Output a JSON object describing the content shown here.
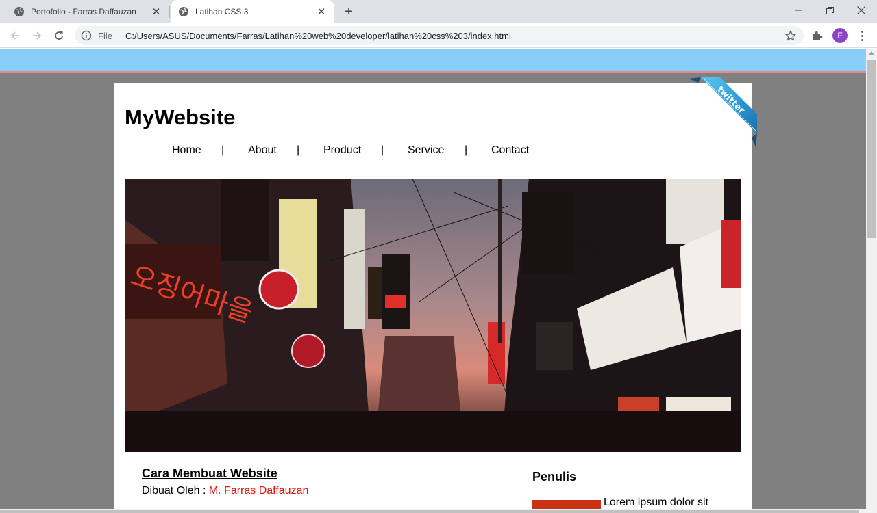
{
  "browser": {
    "tabs": [
      {
        "title": "Portofolio - Farras Daffauzan",
        "active": false
      },
      {
        "title": "Latihan CSS 3",
        "active": true
      }
    ],
    "address": {
      "scheme_label": "File",
      "url": "C:/Users/ASUS/Documents/Farras/Latihan%20web%20developer/latihan%20css%203/index.html"
    },
    "profile_initial": "F"
  },
  "page": {
    "site_title": "MyWebsite",
    "nav": [
      "Home",
      "About",
      "Product",
      "Service",
      "Contact"
    ],
    "nav_separator": "|",
    "ribbon_label": "twitter",
    "article": {
      "title": "Cara Membuat Website",
      "byline_prefix": "Dibuat Oleh : ",
      "author": "M. Farras Daffauzan"
    },
    "sidebar": {
      "title": "Penulis",
      "text": "Lorem ipsum dolor sit"
    }
  },
  "colors": {
    "top_band": "#87cefa",
    "page_background": "#808080",
    "author_link": "#e3120b",
    "avatar": "#8e44c9"
  }
}
